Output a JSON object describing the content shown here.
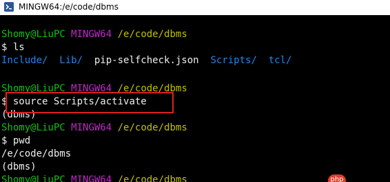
{
  "window": {
    "title": "MINGW64:/e/code/dbms",
    "icon": "mingw-terminal-icon"
  },
  "terminal": {
    "prompt_user_host": "Shomy@LiuPC",
    "prompt_shell": "MINGW64",
    "prompt_path": "/e/code/dbms",
    "dollar": "$",
    "commands": {
      "ls": "ls",
      "source": "source Scripts/activate",
      "pwd": "pwd"
    },
    "ls_output": {
      "include": "Include/",
      "lib": "Lib/",
      "pip": "pip-selfcheck.json",
      "scripts": "Scripts/",
      "tcl": "tcl/"
    },
    "venv_indicator": "(dbms)",
    "pwd_output": "/e/code/dbms"
  },
  "colors": {
    "background": "#000000",
    "user_host": "#13c013",
    "shell": "#c028c8",
    "path": "#c0c000",
    "directory": "#2a82e6",
    "text": "#f0f0f0",
    "highlight_border": "#e02020"
  },
  "watermark": {
    "text": "php"
  }
}
